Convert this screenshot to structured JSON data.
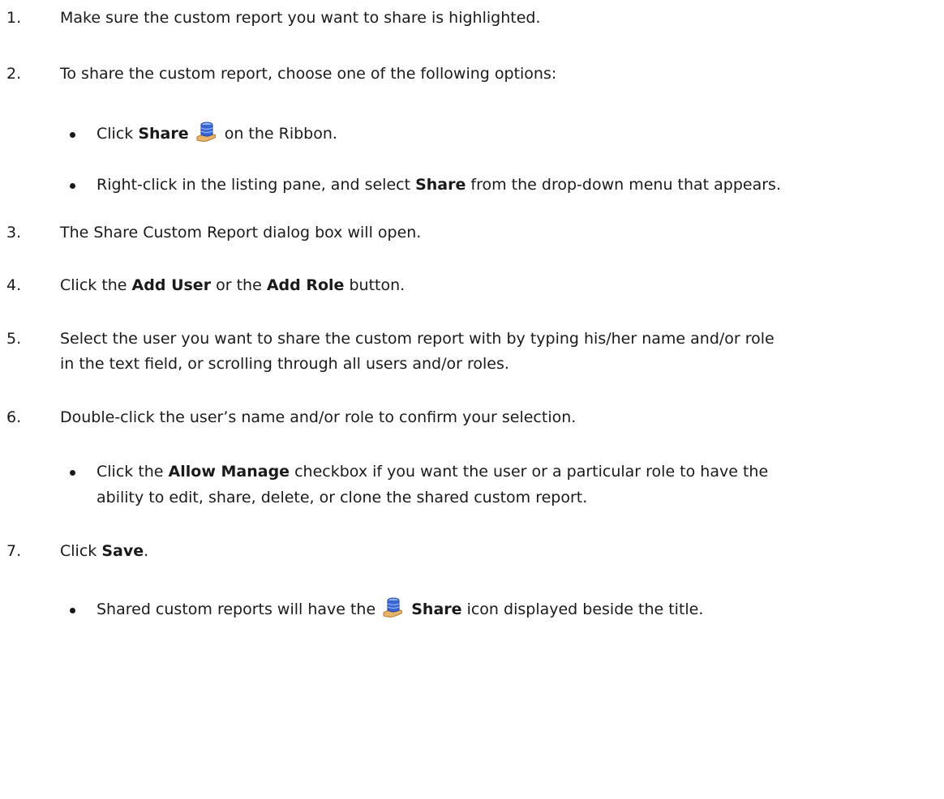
{
  "steps": [
    {
      "num": "1.",
      "text": "Make sure the custom report you want to share is highlighted."
    },
    {
      "num": "2.",
      "text": "To share the custom report, choose one of the following options:"
    },
    {
      "num": "3.",
      "text": "The Share Custom Report dialog box will open."
    },
    {
      "num": "4.",
      "pre": "Click the ",
      "b1": "Add User",
      "mid": " or the ",
      "b2": "Add Role",
      "post": " button."
    },
    {
      "num": "5.",
      "line1": "Select the user you want to share the custom report with by typing his/her name and/or role",
      "line2": "in the text field, or scrolling through all users and/or roles."
    },
    {
      "num": "6.",
      "text": "Double-click the user’s name and/or role to confirm your selection."
    },
    {
      "num": "7.",
      "pre": "Click ",
      "b1": "Save",
      "post": "."
    }
  ],
  "sub": {
    "s2a": {
      "pre": "Click ",
      "b": "Share",
      "post": " on the Ribbon."
    },
    "s2b": {
      "pre": "Right-click in the listing pane, and select ",
      "b": "Share",
      "post": " from the drop-down menu that appears."
    },
    "s6a": {
      "pre": "Click the ",
      "b": "Allow Manage",
      "post": " checkbox if you want the user or a particular role to have the",
      "line2": "ability to edit, share, delete, or clone the shared custom report."
    },
    "s7a": {
      "pre": "Shared custom reports will have the ",
      "b": "Share",
      "post": " icon displayed beside the title."
    }
  }
}
